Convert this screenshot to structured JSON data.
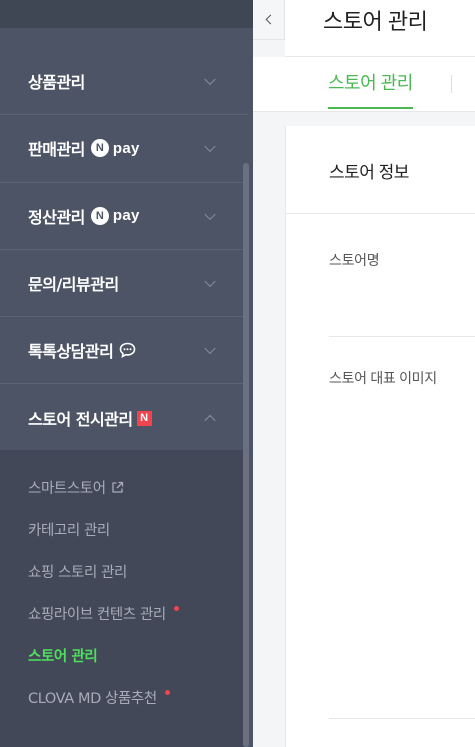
{
  "sidebar": {
    "menu": [
      {
        "label": "상품관리",
        "npay": false
      },
      {
        "label": "판매관리",
        "npay": true
      },
      {
        "label": "정산관리",
        "npay": true
      },
      {
        "label": "문의/리뷰관리",
        "npay": false
      },
      {
        "label": "톡톡상담관리",
        "npay": false,
        "talk": true
      },
      {
        "label": "스토어 전시관리",
        "npay": false,
        "new": true,
        "open": true
      }
    ],
    "npay_n": "N",
    "npay_text": "pay",
    "new_badge": "N",
    "submenu": [
      {
        "label": "스마트스토어",
        "external": true
      },
      {
        "label": "카테고리 관리"
      },
      {
        "label": "쇼핑 스토리 관리"
      },
      {
        "label": "쇼핑라이브 컨텐츠 관리",
        "dot": true
      },
      {
        "label": "스토어 관리",
        "active": true
      },
      {
        "label": "CLOVA MD 상품추천",
        "dot": true
      }
    ]
  },
  "main": {
    "page_title": "스토어 관리",
    "tab_label": "스토어 관리",
    "card_title": "스토어 정보",
    "fields": [
      "스토어명",
      "스토어 대표 이미지"
    ]
  },
  "colors": {
    "sidebar_bg": "#4d5465",
    "submenu_bg": "#424857",
    "accent_green": "#4bb852",
    "active_green": "#4ee05c",
    "badge_red": "#f0454f"
  }
}
